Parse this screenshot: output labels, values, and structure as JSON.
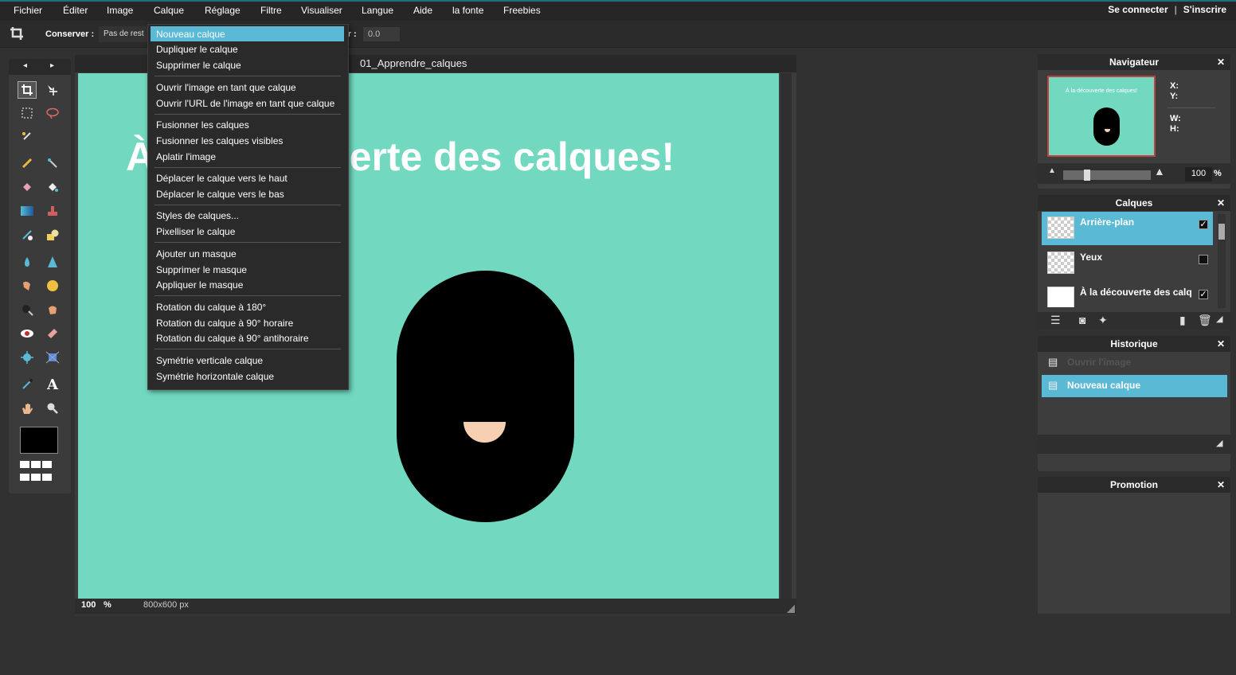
{
  "menubar": {
    "items": [
      "Fichier",
      "Éditer",
      "Image",
      "Calque",
      "Réglage",
      "Filtre",
      "Visualiser",
      "Langue",
      "Aide",
      "la fonte",
      "Freebies"
    ],
    "login": "Se connecter",
    "separator": "|",
    "signup": "S'inscrire"
  },
  "options": {
    "keep_label": "Conserver :",
    "keep_value": "Pas de rest",
    "field_suffix": "ur :",
    "field_value": "0.0"
  },
  "tools": {
    "nav_left": "◂",
    "nav_right": "▸",
    "icons": [
      "crop-icon",
      "move-icon",
      "marquee-icon",
      "lasso-icon",
      "magic-wand-icon",
      "pencil-icon",
      "brush-icon",
      "eraser-icon",
      "bucket-icon",
      "gradient-icon",
      "stamp-icon",
      "color-replace-icon",
      "shape-icon",
      "blur-icon",
      "sharpen-icon",
      "smudge-icon",
      "sponge-icon",
      "dodge-icon",
      "burn-icon",
      "red-eye-icon",
      "spot-heal-icon",
      "bloat-icon",
      "pinch-icon",
      "color-picker-icon",
      "type-icon",
      "hand-icon",
      "zoom-icon"
    ],
    "foreground_color": "#000000"
  },
  "document": {
    "title": "01_Apprendre_calques",
    "canvas_text": "À la découverte des calques!",
    "canvas_color": "#72d8c0",
    "zoom": "100",
    "zoom_unit": "%",
    "dimensions": "800x600 px"
  },
  "dropdown": {
    "groups": [
      [
        "Nouveau calque",
        "Dupliquer le calque",
        "Supprimer le calque"
      ],
      [
        "Ouvrir l'image en tant que calque",
        "Ouvrir l'URL de l'image en tant que calque"
      ],
      [
        "Fusionner les calques",
        "Fusionner les calques visibles",
        "Aplatir l'image"
      ],
      [
        "Déplacer le calque vers le haut",
        "Déplacer le calque vers le bas"
      ],
      [
        "Styles de calques...",
        "Pixelliser le calque"
      ],
      [
        "Ajouter un masque",
        "Supprimer le masque",
        "Appliquer le masque"
      ],
      [
        "Rotation du calque à 180°",
        "Rotation du calque à 90° horaire",
        "Rotation du calque à 90° antihoraire"
      ],
      [
        "Symétrie verticale calque",
        "Symétrie horizontale calque"
      ]
    ],
    "active": "Nouveau calque"
  },
  "navigator": {
    "title": "Navigateur",
    "close": "✕",
    "thumb_text": "À la découverte des calques!",
    "x_label": "X:",
    "y_label": "Y:",
    "w_label": "W:",
    "h_label": "H:",
    "zoom": "100",
    "zoom_unit": "%",
    "zoom_slider_level": 0.25
  },
  "layers": {
    "title": "Calques",
    "close": "✕",
    "items": [
      {
        "name": "Arrière-plan",
        "visible": true
      },
      {
        "name": "Yeux",
        "visible": false
      },
      {
        "name": "À la découverte des calq",
        "visible": true
      }
    ]
  },
  "history": {
    "title": "Historique",
    "close": "✕",
    "items": [
      "Ouvrir l'image",
      "Nouveau calque"
    ]
  },
  "promotion": {
    "title": "Promotion",
    "close": "✕"
  },
  "colors": {
    "accent": "#5ab9d5",
    "canvas": "#72d8c0",
    "skin": "#f7d0b3"
  }
}
